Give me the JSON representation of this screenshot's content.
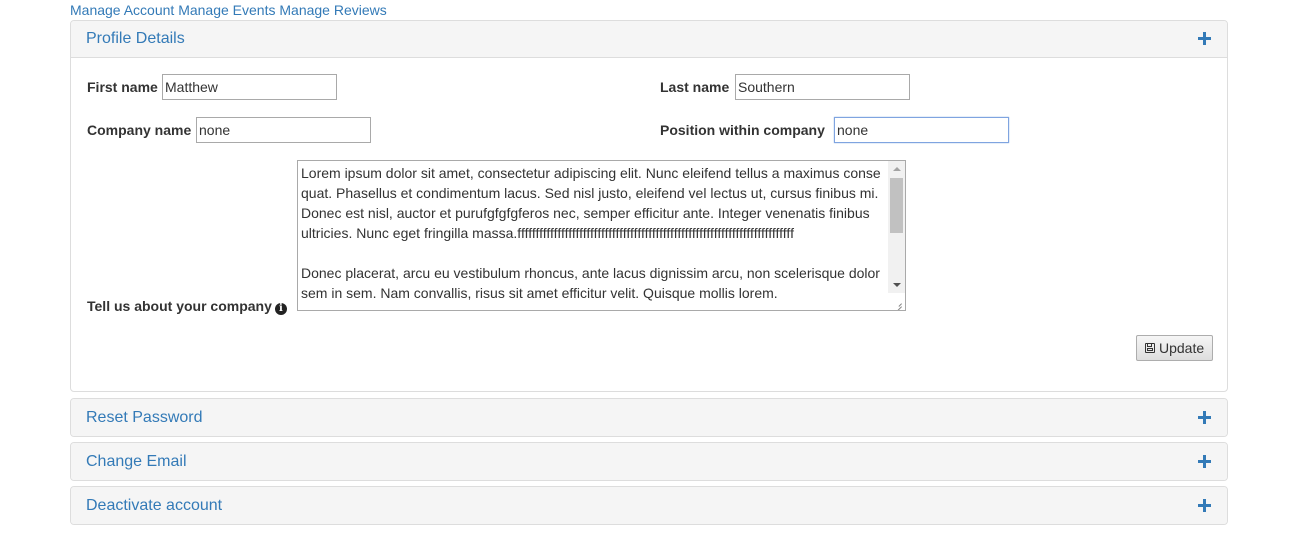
{
  "topnav": {
    "links": [
      "Manage Account",
      "Manage Events",
      "Manage Reviews"
    ]
  },
  "profile": {
    "title": "Profile Details",
    "toggle_icon": "plus-icon",
    "first_name_label": "First name",
    "first_name_value": "Matthew",
    "last_name_label": "Last name",
    "last_name_value": "Southern",
    "company_name_label": "Company name",
    "company_name_value": "none",
    "position_label": "Position within company",
    "position_value": "none",
    "about_label": "Tell us about your company",
    "about_info_icon": "info-circle-icon",
    "about_value": "Lorem ipsum dolor sit amet, consectetur adipiscing elit. Nunc eleifend tellus a maximus consequat. Phasellus et condimentum lacus. Sed nisl justo, eleifend vel lectus ut, cursus finibus mi. Donec est nisl, auctor et purufgfgfgferos nec, semper efficitur ante. Integer venenatis finibus ultricies. Nunc eget fringilla massa.ffffffffffffffffffffffffffffffffffffffffffffffffffffffffffffffffffffffffffff\n\nDonec placerat, arcu eu vestibulum rhoncus, ante lacus dignissim arcu, non scelerisque dolor sem in sem. Nam convallis, risus sit amet efficitur velit. Quisque mollis lorem.",
    "update_label": "Update",
    "update_icon": "floppy-disk-icon"
  },
  "panels": [
    {
      "title": "Reset Password",
      "icon": "plus-icon"
    },
    {
      "title": "Change Email",
      "icon": "plus-icon"
    },
    {
      "title": "Deactivate account",
      "icon": "plus-icon"
    }
  ]
}
